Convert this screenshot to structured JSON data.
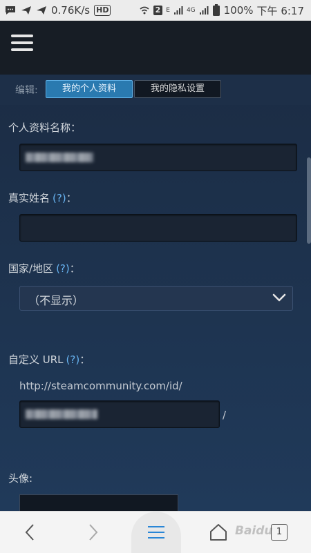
{
  "status_bar": {
    "speed": "0.76K/s",
    "hd": "HD",
    "sim_badge": "2",
    "net_e": "E",
    "net_4g": "4G",
    "battery": "100%",
    "time": "下午 6:17"
  },
  "tabs": {
    "edit_label": "编辑:",
    "profile": "我的个人资料",
    "privacy": "我的隐私设置"
  },
  "form": {
    "profile_name_label": "个人资料名称：",
    "real_name_label": "真实姓名",
    "country_label": "国家/地区",
    "country_value": "（不显示）",
    "custom_url_label": "自定义 URL",
    "url_prefix": "http://steamcommunity.com/id/",
    "url_suffix": "/",
    "avatar_label": "头像:",
    "help_mark": "(?)",
    "colon": "："
  },
  "bottom_nav": {
    "tab_count": "1",
    "watermark": "Baidu"
  }
}
